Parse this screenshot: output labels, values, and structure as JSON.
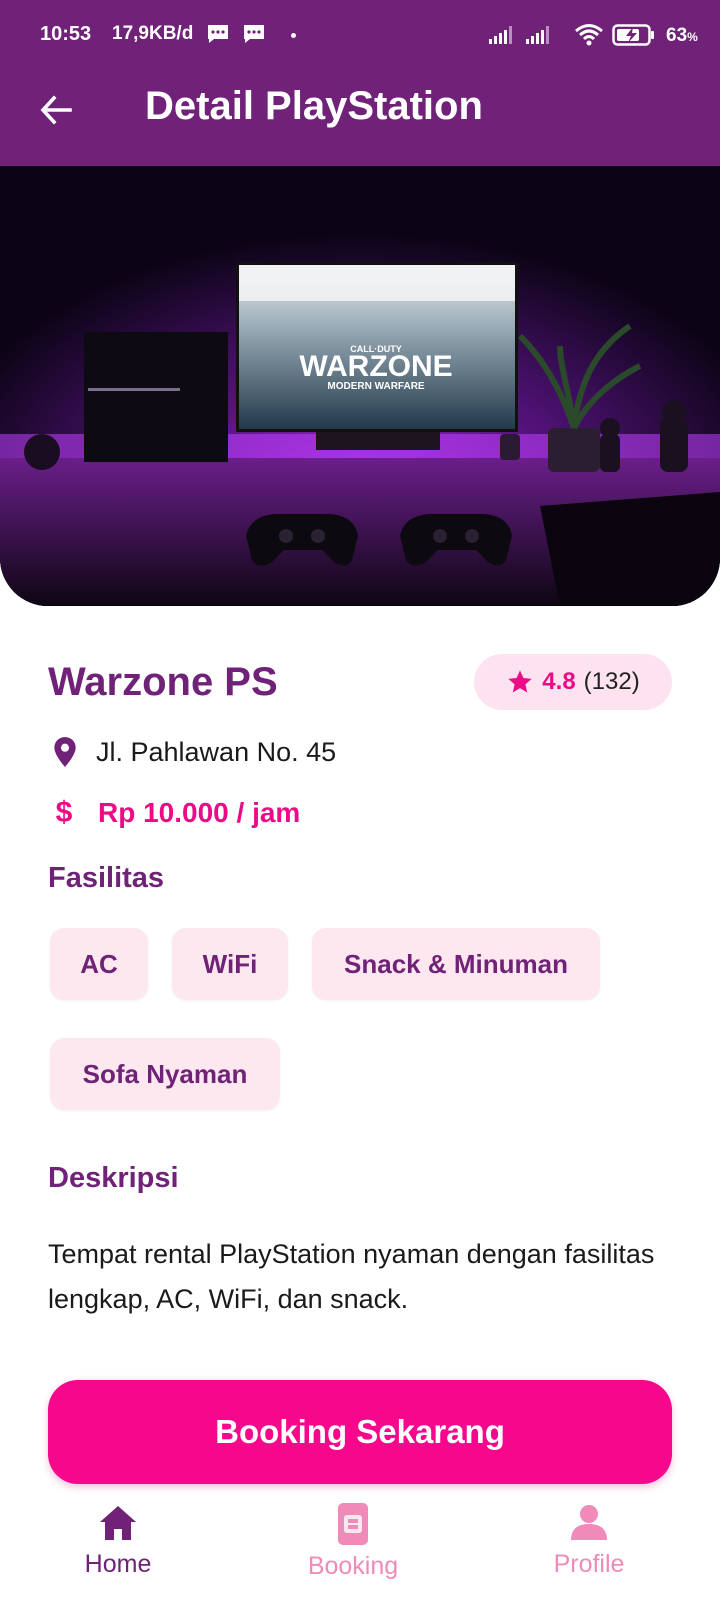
{
  "status_bar": {
    "time": "10:53",
    "net_speed": "17,9KB/d",
    "battery": "63",
    "battery_unit": "%"
  },
  "app_bar": {
    "title": "Detail PlayStation",
    "back_icon": "arrow-left-icon"
  },
  "hero": {
    "screen_line1": "CALL·DUTY",
    "screen_line2": "WARZONE",
    "screen_line3": "MODERN WARFARE"
  },
  "place": {
    "name": "Warzone PS",
    "rating": "4.8",
    "rating_count": "(132)",
    "address": "Jl. Pahlawan No. 45",
    "price": "Rp 10.000 / jam"
  },
  "facilities": {
    "heading": "Fasilitas",
    "items": [
      "AC",
      "WiFi",
      "Snack & Minuman",
      "Sofa Nyaman"
    ]
  },
  "description": {
    "heading": "Deskripsi",
    "text": "Tempat rental PlayStation nyaman dengan fasilitas lengkap, AC, WiFi, dan snack."
  },
  "cta": {
    "label": "Booking Sekarang"
  },
  "bottom_nav": {
    "items": [
      {
        "label": "Home",
        "icon": "home-icon",
        "active": true
      },
      {
        "label": "Booking",
        "icon": "booking-icon",
        "active": false
      },
      {
        "label": "Profile",
        "icon": "person-icon",
        "active": false
      }
    ]
  },
  "colors": {
    "primary": "#6f2277",
    "accent": "#ec0a87",
    "button": "#f7078b",
    "chip_bg": "#fde8f0",
    "nav_inactive": "#f08ab8"
  }
}
